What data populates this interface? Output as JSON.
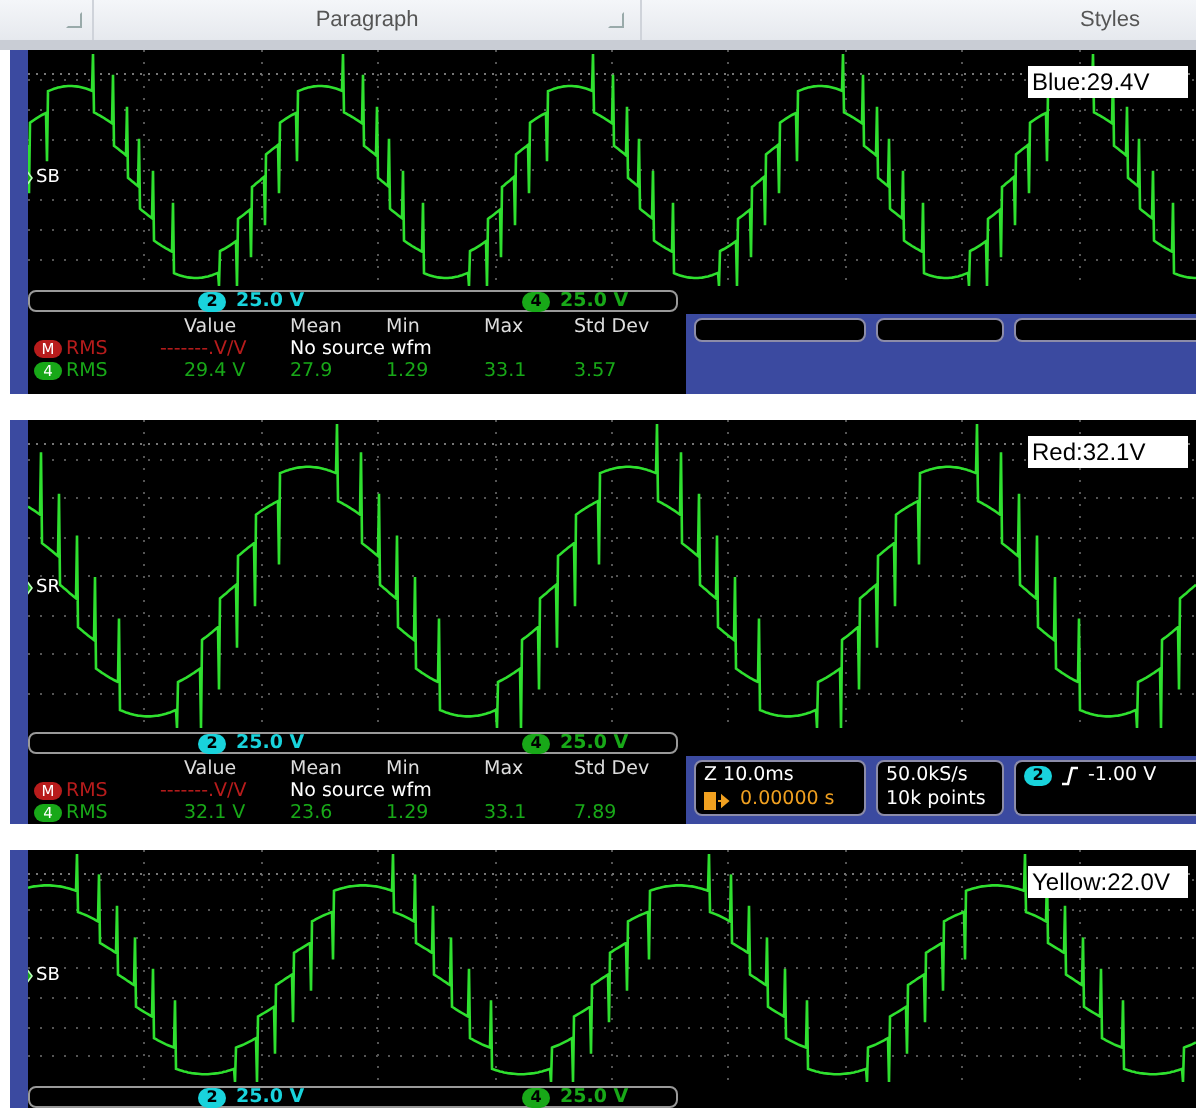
{
  "ribbon": {
    "groups": [
      "Paragraph",
      "Styles"
    ]
  },
  "scopes": [
    {
      "label": "Blue:29.4V",
      "marker": "SB",
      "channels": [
        {
          "number": "2",
          "value": "25.0 V",
          "color": "#19d3dc"
        },
        {
          "number": "4",
          "value": "25.0 V",
          "color": "#18a818"
        }
      ],
      "measurements": {
        "columns": [
          "Value",
          "Mean",
          "Min",
          "Max",
          "Std Dev"
        ],
        "rows": [
          {
            "source": "M",
            "name": "RMS",
            "color": "#b81c1c",
            "value": "-------.V/V",
            "note": "No source wfm"
          },
          {
            "source": "4",
            "name": "RMS",
            "color": "#18a818",
            "cells": [
              "29.4 V",
              "27.9",
              "1.29",
              "33.1",
              "3.57"
            ]
          }
        ]
      }
    },
    {
      "label": "Red:32.1V",
      "marker": "SR",
      "channels": [
        {
          "number": "2",
          "value": "25.0 V",
          "color": "#19d3dc"
        },
        {
          "number": "4",
          "value": "25.0 V",
          "color": "#18a818"
        }
      ],
      "measurements": {
        "columns": [
          "Value",
          "Mean",
          "Min",
          "Max",
          "Std Dev"
        ],
        "rows": [
          {
            "source": "M",
            "name": "RMS",
            "color": "#b81c1c",
            "value": "-------.V/V",
            "note": "No source wfm"
          },
          {
            "source": "4",
            "name": "RMS",
            "color": "#18a818",
            "cells": [
              "32.1 V",
              "23.6",
              "1.29",
              "33.1",
              "7.89"
            ]
          }
        ]
      },
      "info": {
        "timebase": "Z 10.0ms",
        "trigger_position": "0.00000 s",
        "sample_rate": "50.0kS/s",
        "record_length": "10k points",
        "trigger": {
          "channel": "2",
          "level": "-1.00 V",
          "color": "#19d3dc"
        }
      }
    },
    {
      "label": "Yellow:22.0V",
      "marker": "SB",
      "channels": [
        {
          "number": "2",
          "value": "25.0 V",
          "color": "#19d3dc"
        },
        {
          "number": "4",
          "value": "25.0 V",
          "color": "#18a818"
        }
      ]
    }
  ]
}
